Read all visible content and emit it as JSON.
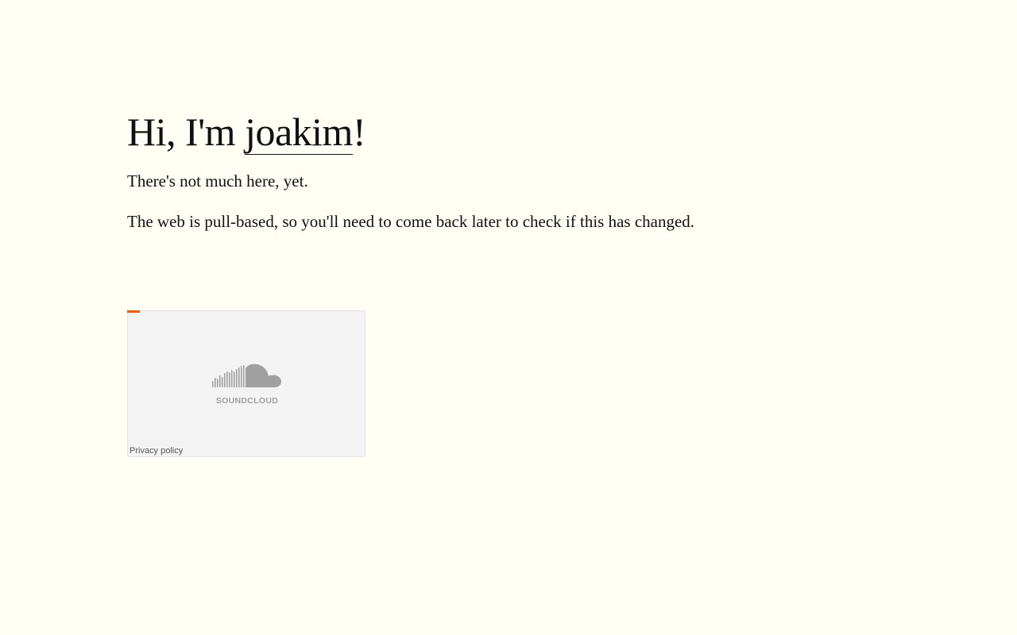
{
  "heading": {
    "prefix": "Hi, I'm ",
    "name_link": "joakim",
    "suffix": "!"
  },
  "paragraphs": [
    "There's not much here, yet.",
    "The web is pull-based, so you'll need to come back later to check if this has changed."
  ],
  "embed": {
    "logo_text": "SOUNDCLOUD",
    "icon": "soundcloud-logo-icon",
    "privacy_link": "Privacy policy",
    "loading_color": "#ff5500",
    "logo_color": "#a0a0a0"
  },
  "colors": {
    "background": "#fffff6",
    "text": "#111111",
    "accent": "#ff5500"
  }
}
